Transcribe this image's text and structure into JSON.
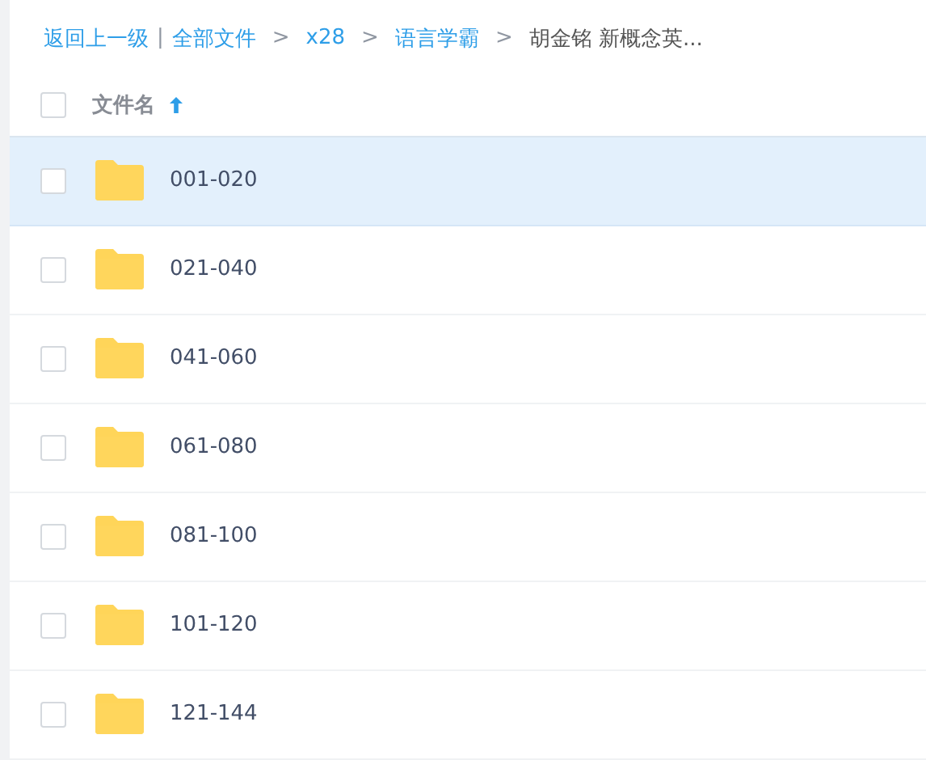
{
  "breadcrumb": [
    {
      "kind": "link",
      "text": "返回上一级"
    },
    {
      "kind": "bar",
      "text": "|"
    },
    {
      "kind": "link",
      "text": "全部文件"
    },
    {
      "kind": "sep",
      "text": ">"
    },
    {
      "kind": "link",
      "text": "x28"
    },
    {
      "kind": "sep",
      "text": ">"
    },
    {
      "kind": "link",
      "text": "语言学霸"
    },
    {
      "kind": "sep",
      "text": ">"
    },
    {
      "kind": "current",
      "text": "胡金铭 新概念英..."
    }
  ],
  "header": {
    "label": "文件名",
    "checked": false,
    "sort_ascending": true
  },
  "rows": [
    {
      "name": "001-020",
      "checked": false,
      "selected": true
    },
    {
      "name": "021-040",
      "checked": false,
      "selected": false
    },
    {
      "name": "041-060",
      "checked": false,
      "selected": false
    },
    {
      "name": "061-080",
      "checked": false,
      "selected": false
    },
    {
      "name": "081-100",
      "checked": false,
      "selected": false
    },
    {
      "name": "101-120",
      "checked": false,
      "selected": false
    },
    {
      "name": "121-144",
      "checked": false,
      "selected": false
    }
  ]
}
